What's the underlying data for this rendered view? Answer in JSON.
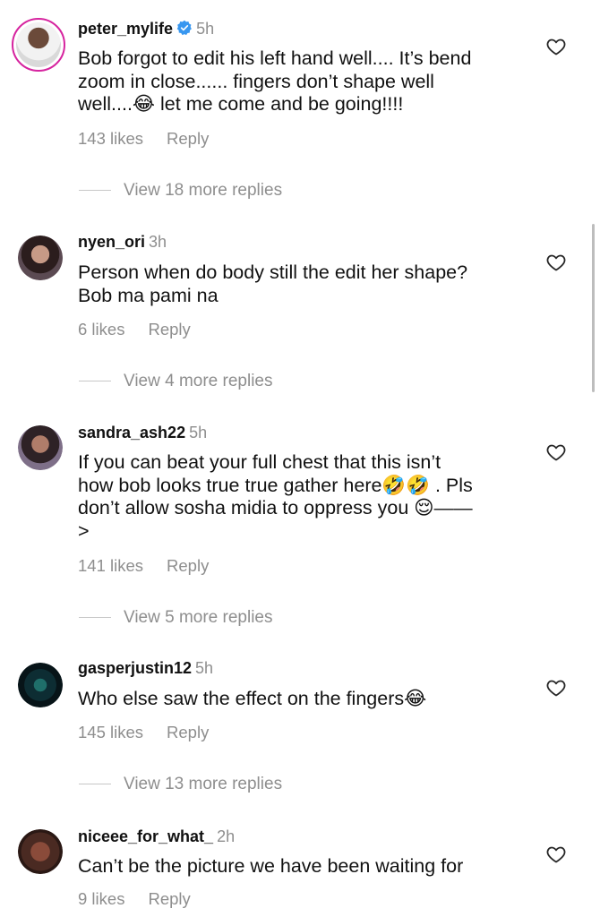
{
  "comments": [
    {
      "username": "peter_mylife",
      "verified": true,
      "time": "5h",
      "text": "Bob forgot to edit his left hand well.... It’s bend\nzoom in close...... fingers don’t shape well\nwell....😂 let me come and be going!!!!",
      "likes": "143 likes",
      "reply": "Reply",
      "view_replies": "View 18 more replies"
    },
    {
      "username": "nyen_ori",
      "time": "3h",
      "text": "Person when do body still the edit her shape?\nBob ma pami na",
      "likes": "6 likes",
      "reply": "Reply",
      "view_replies": "View 4 more replies"
    },
    {
      "username": "sandra_ash22",
      "time": "5h",
      "text": "If you can beat your full chest that this isn’t\nhow bob looks true true gather here🤣🤣 . Pls\ndon’t allow sosha midia to oppress you 😌——\n>",
      "likes": "141 likes",
      "reply": "Reply",
      "view_replies": "View 5 more replies"
    },
    {
      "username": "gasperjustin12",
      "time": "5h",
      "text": "Who else saw the effect on the fingers😂",
      "likes": "145 likes",
      "reply": "Reply",
      "view_replies": "View 13 more replies"
    },
    {
      "username": "niceee_for_what_",
      "time": "2h",
      "text": "Can’t be the picture we have been waiting for",
      "likes": "9 likes",
      "reply": "Reply"
    }
  ],
  "icons": {
    "like": "heart-outline-icon",
    "verified": "verified-badge-icon"
  },
  "colors": {
    "muted": "#8e8e8e",
    "verified": "#3897f0",
    "story_ring": "#d6249f"
  }
}
